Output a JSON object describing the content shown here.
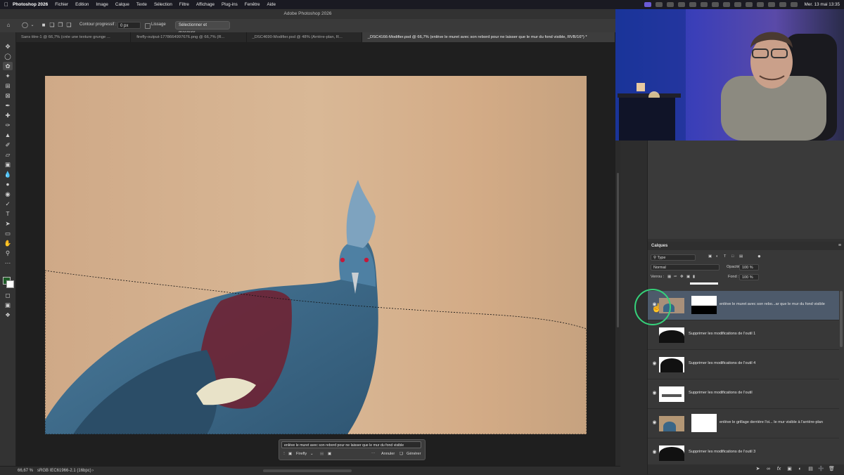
{
  "menubar": {
    "app": "Photoshop 2026",
    "items": [
      "Fichier",
      "Edition",
      "Image",
      "Calque",
      "Texte",
      "Sélection",
      "Filtre",
      "Affichage",
      "Plug-ins",
      "Fenêtre",
      "Aide"
    ],
    "clock": "Mer. 13 mai 13:35"
  },
  "window_title": "Adobe Photoshop 2026",
  "options": {
    "feather_label": "Contour progressif :",
    "feather_value": "0 px",
    "antialias_label": "Lissage",
    "select_mask_button": "Sélectionner et masquer..."
  },
  "tabs": [
    "Sans titre-1 @ 66,7% (crée une texture grunge ...",
    "firefly-output-1778664997676.png @ 66,7% (R...",
    "_DSC4690-Modifier.psd @ 48% (Arrière-plan, R...",
    "_DSC4166-Modifier.psd @ 66,7% (enlève le muret avec son rebord pour ne laisser que le mur du fond visible, RVB/16*) *"
  ],
  "active_tab_index": 3,
  "contextual_bar": {
    "prompt": "enlève le muret avec son rebord pour ne laisser que le mur du fond visible",
    "model": "Firefly",
    "cancel": "Annuler",
    "generate": "Générer"
  },
  "status": {
    "zoom": "66,67 %",
    "profile": "sRGB IEC61966-2.1 (16bpc)",
    "arrow": "›"
  },
  "layers_panel": {
    "title": "Calques",
    "filter": "Type",
    "blend_mode": "Normal",
    "opacity_label": "Opacité :",
    "opacity_value": "100 %",
    "lock_label": "Verrou :",
    "fill_label": "Fond :",
    "fill_value": "100 %",
    "layers": [
      {
        "name": "enlève le muret avec son rebo...ar que le mur du fond visible",
        "visible": true,
        "selected": true
      },
      {
        "name": "Supprimer les modifications de l'outil 1",
        "visible": false,
        "selected": false
      },
      {
        "name": "Supprimer les modifications de l'outil 4",
        "visible": true,
        "selected": false
      },
      {
        "name": "Supprimer les modifications de l'outil",
        "visible": true,
        "selected": false
      },
      {
        "name": "enlève le grillage derrière l'oi... le mur visible à l'arrière-plan",
        "visible": true,
        "selected": false
      },
      {
        "name": "Supprimer les modifications de l'outil 3",
        "visible": true,
        "selected": false
      }
    ]
  },
  "colors": {
    "accent_selection": "#4d5a6b",
    "highlight_ring": "#35d27a",
    "wall": "#d9b896",
    "bird": "#3f6e8f",
    "bird_chest": "#6e2434"
  }
}
